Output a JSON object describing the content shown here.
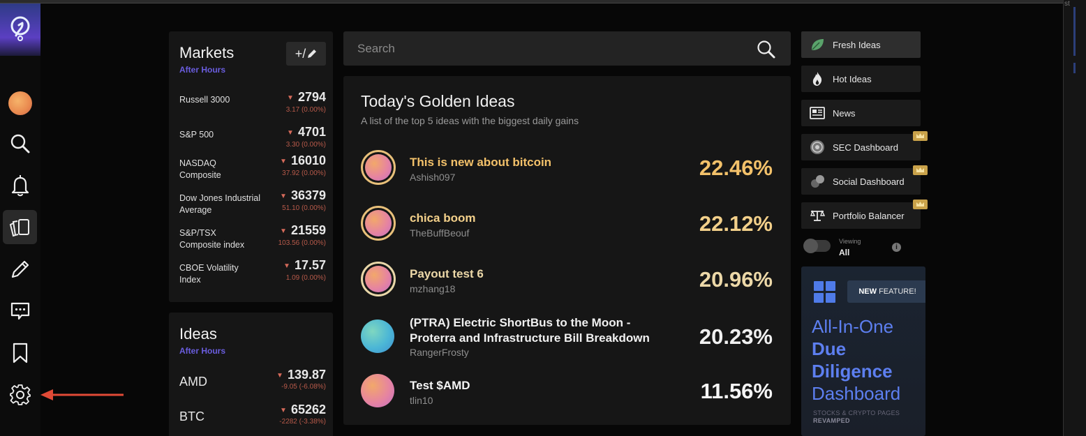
{
  "colors": {
    "accent_purple": "#6a5ddf",
    "gold": "#f3c16a",
    "negative": "#d56a5a",
    "promo_blue": "#5d7ff0",
    "arrow_red": "#e04a36"
  },
  "nav": {
    "items": [
      {
        "icon": "logo-icon"
      },
      {
        "icon": "user-avatar-icon"
      },
      {
        "icon": "search-icon"
      },
      {
        "icon": "bell-icon"
      },
      {
        "icon": "cards-icon",
        "active": true
      },
      {
        "icon": "pencil-icon"
      },
      {
        "icon": "chat-icon"
      },
      {
        "icon": "bookmark-icon"
      },
      {
        "icon": "gear-icon"
      }
    ]
  },
  "markets": {
    "title": "Markets",
    "subtitle": "After Hours",
    "add_label": "+/",
    "rows": [
      {
        "name": "Russell 3000",
        "value": "2794",
        "change": "3.17 (0.00%)"
      },
      {
        "name": "S&P 500",
        "value": "4701",
        "change": "3.30 (0.00%)"
      },
      {
        "name": "NASDAQ Composite",
        "value": "16010",
        "change": "37.92 (0.00%)"
      },
      {
        "name": "Dow Jones Industrial Average",
        "value": "36379",
        "change": "51.10 (0.00%)"
      },
      {
        "name": "S&P/TSX Composite index",
        "value": "21559",
        "change": "103.56 (0.00%)"
      },
      {
        "name": "CBOE Volatility Index",
        "value": "17.57",
        "change": "1.09 (0.00%)"
      }
    ]
  },
  "ideas": {
    "title": "Ideas",
    "subtitle": "After Hours",
    "rows": [
      {
        "name": "AMD",
        "value": "139.87",
        "change": "-9.05 (-6.08%)"
      },
      {
        "name": "BTC",
        "value": "65262",
        "change": "-2282 (-3.38%)"
      }
    ]
  },
  "search": {
    "placeholder": "Search"
  },
  "golden": {
    "title": "Today's Golden Ideas",
    "subtitle": "A list of the top 5 ideas with the biggest daily gains",
    "rows": [
      {
        "title": "This is new about bitcoin",
        "author": "Ashish097",
        "pct": "22.46%",
        "color": "#f3c16a"
      },
      {
        "title": "chica boom",
        "author": "TheBuffBeouf",
        "pct": "22.12%",
        "color": "#f3d08a"
      },
      {
        "title": "Payout test 6",
        "author": "mzhang18",
        "pct": "20.96%",
        "color": "#ecd8a8"
      },
      {
        "title": "(PTRA) Electric ShortBus to the Moon - Proterra and Infrastructure Bill Breakdown",
        "author": "RangerFrosty",
        "pct": "20.23%",
        "color": "#f0f0f0"
      },
      {
        "title": "Test $AMD",
        "author": "tlin10",
        "pct": "11.56%",
        "color": "#f5f5f5"
      }
    ]
  },
  "sidebar": {
    "buttons": [
      {
        "label": "Fresh Ideas",
        "icon": "leaf-icon"
      },
      {
        "label": "Hot Ideas",
        "icon": "flame-icon"
      },
      {
        "label": "News",
        "icon": "newspaper-icon"
      },
      {
        "label": "SEC Dashboard",
        "icon": "sec-seal-icon",
        "premium": true
      },
      {
        "label": "Social Dashboard",
        "icon": "social-icon",
        "premium": true
      },
      {
        "label": "Portfolio Balancer",
        "icon": "balance-icon",
        "premium": true
      }
    ],
    "viewing_label": "Viewing",
    "viewing_value": "All"
  },
  "promo": {
    "badge_new": "NEW",
    "badge_rest": " FEATURE!",
    "line1": "All-In-One",
    "line2": "Due",
    "line3": "Diligence",
    "line4": "Dashboard",
    "small1": "STOCKS & CRYPTO PAGES",
    "small2": "REVAMPED"
  }
}
